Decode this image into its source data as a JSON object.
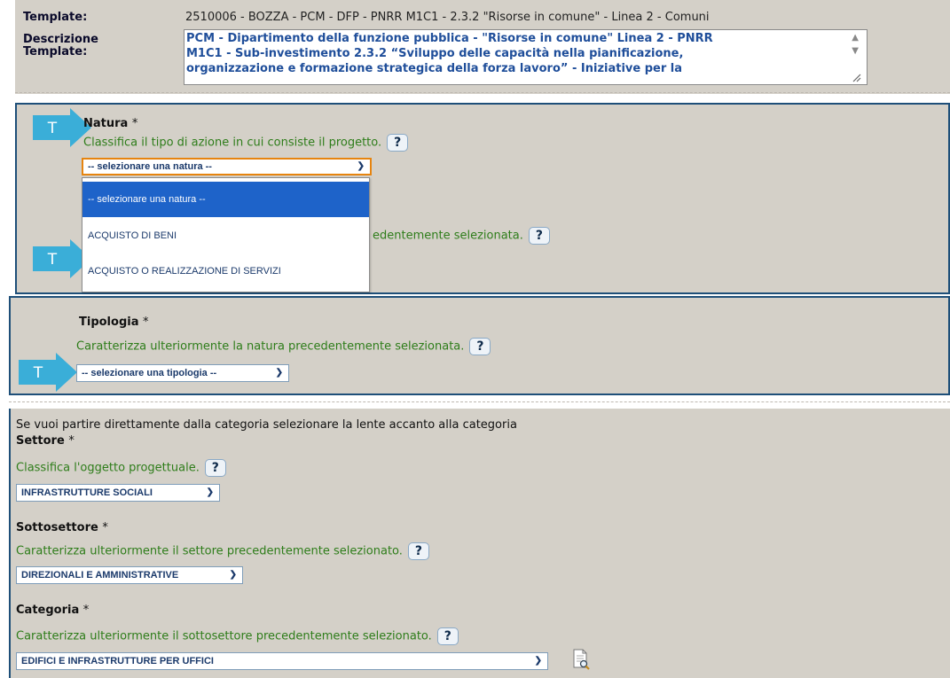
{
  "template": {
    "label": "Template:",
    "value": "2510006 - BOZZA - PCM - DFP - PNRR M1C1 - 2.3.2 \"Risorse in comune\" - Linea 2 - Comuni",
    "desc_label_1": "Descrizione",
    "desc_label_2": "Template:",
    "description_lines": [
      "PCM - Dipartimento della funzione pubblica -  \"Risorse in comune\" Linea 2 - PNRR",
      "M1C1 - Sub-investimento 2.3.2 “Sviluppo delle capacità nella pianificazione,",
      "organizzazione e formazione strategica della forza lavoro” - Iniziative per la"
    ]
  },
  "natura": {
    "badge": "T",
    "title": "Natura",
    "required_mark": "*",
    "hint": "Classifica il tipo di azione in cui consiste il progetto.",
    "help": "?",
    "selected": "-- selezionare una natura --",
    "options": [
      "-- selezionare una natura --",
      "ACQUISTO DI BENI",
      "ACQUISTO O REALIZZAZIONE DI SERVIZI"
    ],
    "hidden_hint_tail": "edentemente selezionata.",
    "hidden_help": "?"
  },
  "tipologia": {
    "badge": "T",
    "title": "Tipologia",
    "required_mark": "*",
    "hint": "Caratterizza ulteriormente la natura precedentemente selezionata.",
    "help": "?",
    "selected": "-- selezionare una tipologia --"
  },
  "categoria_section": {
    "intro": "Se vuoi partire direttamente dalla categoria selezionare la lente accanto alla categoria",
    "settore": {
      "title": "Settore",
      "required_mark": "*",
      "hint": "Classifica l'oggetto progettuale.",
      "help": "?",
      "selected": "INFRASTRUTTURE SOCIALI"
    },
    "sottosettore": {
      "title": "Sottosettore",
      "required_mark": "*",
      "hint": "Caratterizza ulteriormente il settore precedentemente selezionato.",
      "help": "?",
      "selected": "DIREZIONALI E AMMINISTRATIVE"
    },
    "categoria": {
      "title": "Categoria",
      "required_mark": "*",
      "hint": "Caratterizza ulteriormente il sottosettore precedentemente selezionato.",
      "help": "?",
      "selected": "EDIFICI E INFRASTRUTTURE PER UFFICI",
      "lens_icon": "document-search-icon"
    }
  },
  "colors": {
    "panel_bg": "#d4d0c8",
    "border_blue": "#1e4f79",
    "hint_green": "#2e7d1a",
    "t_badge": "#3aaed8",
    "focus_orange": "#e6840f",
    "option_highlight": "#1e63c9"
  }
}
